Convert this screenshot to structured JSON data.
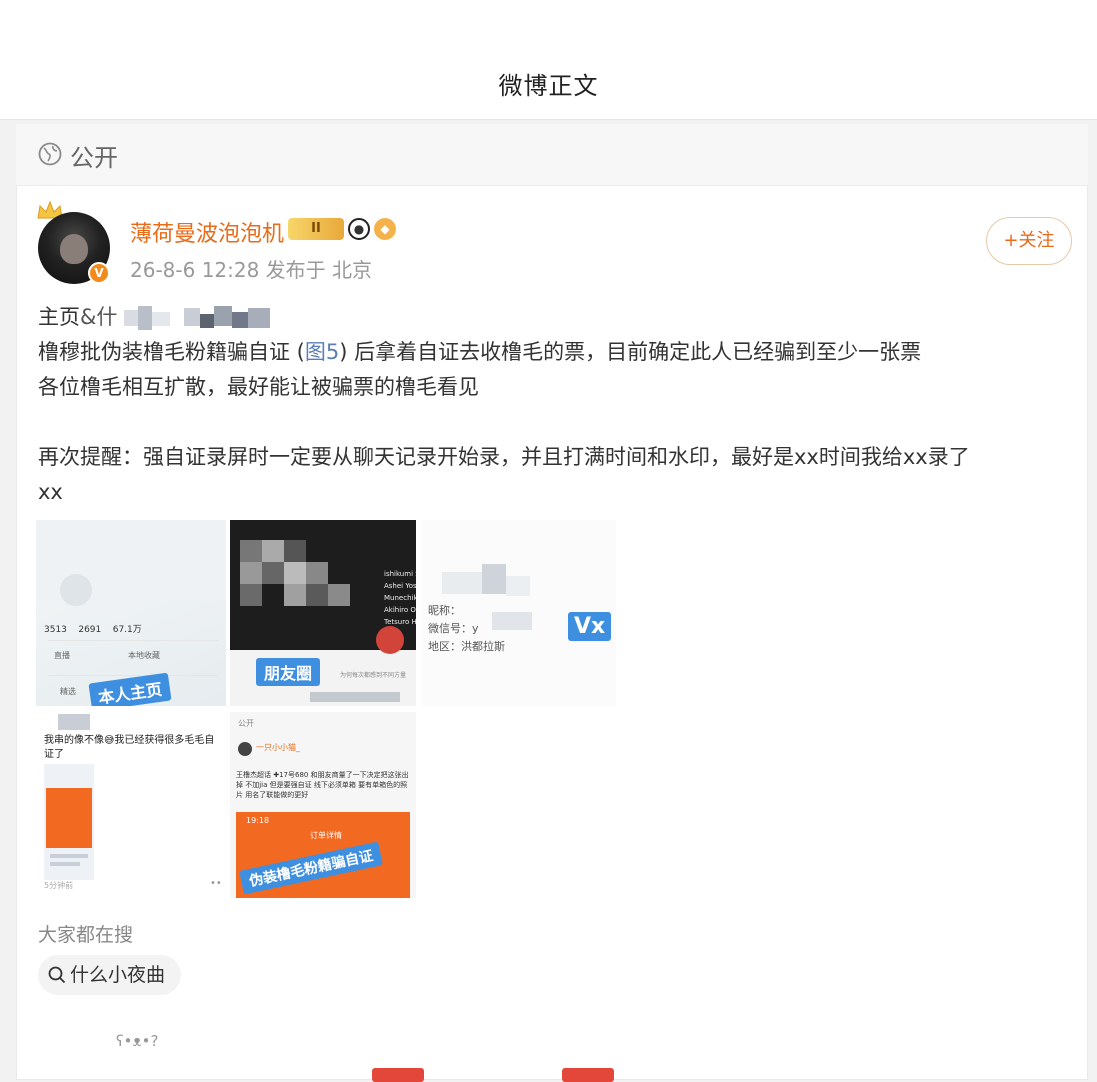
{
  "header": {
    "title": "微博正文"
  },
  "visibility": {
    "label": "公开"
  },
  "post": {
    "username": "薄荷曼波泡泡机",
    "level_badge": "II",
    "meta": "26-8-6 12:28  发布于 北京",
    "follow_label": "+关注",
    "line1_prefix": "主页",
    "line1_mark": "&什",
    "line2_a": "橹穆批伪装橹毛粉籍骗自证 (",
    "line2_link": "图5",
    "line2_b": ") 后拿着自证去收橹毛的票，目前确定此人已经骗到至少一张票",
    "line3": "各位橹毛相互扩散，最好能让被骗票的橹毛看见",
    "line4": "再次提醒：强自证录屏时一定要从聊天记录开始录，并且打满时间和水印，最好是xx时间我给xx录了",
    "line5": "xx"
  },
  "images": {
    "img1_tag": "本人主页",
    "img1_stats": [
      "3513",
      "2691",
      "67.1万"
    ],
    "img1_items": [
      "直播",
      "本地收藏",
      "精选"
    ],
    "img2_tag": "朋友圈",
    "img2_names": [
      "ishikumi S",
      "Ashei Yoshi",
      "Munechika I",
      "Akihiro Ozak",
      "Tetsuro Haya"
    ],
    "img2_caption": "为何每次都感到不同方量",
    "img3_fields": [
      "昵称：",
      "微信号：y",
      "地区：洪都拉斯"
    ],
    "img3_tag": "Vx",
    "img4_text": "我串的像不像😅我已经获得很多毛毛自证了",
    "img4_time": "5分钟前",
    "img5_visibility": "公开",
    "img5_user": "一只小小猫_",
    "img5_body": "王橹杰超话 ✚17号680 和朋友商量了一下决定把这张出掉 不加jia 但是要强自证 线下必须单箱 要有单箱色的照片 用名了联能做的更好",
    "img5_tag": "伪装橹毛粉籍骗自证",
    "img5_order": "订单详情",
    "img5_time": "19:18"
  },
  "search": {
    "label": "大家都在搜",
    "chip": "什么小夜曲",
    "faint": "ʕ•ᴥ•?"
  },
  "colors": {
    "accent": "#e86b1a",
    "link": "#5b7eb5",
    "tag_blue": "#3f8fe0",
    "orange": "#f26a21"
  }
}
